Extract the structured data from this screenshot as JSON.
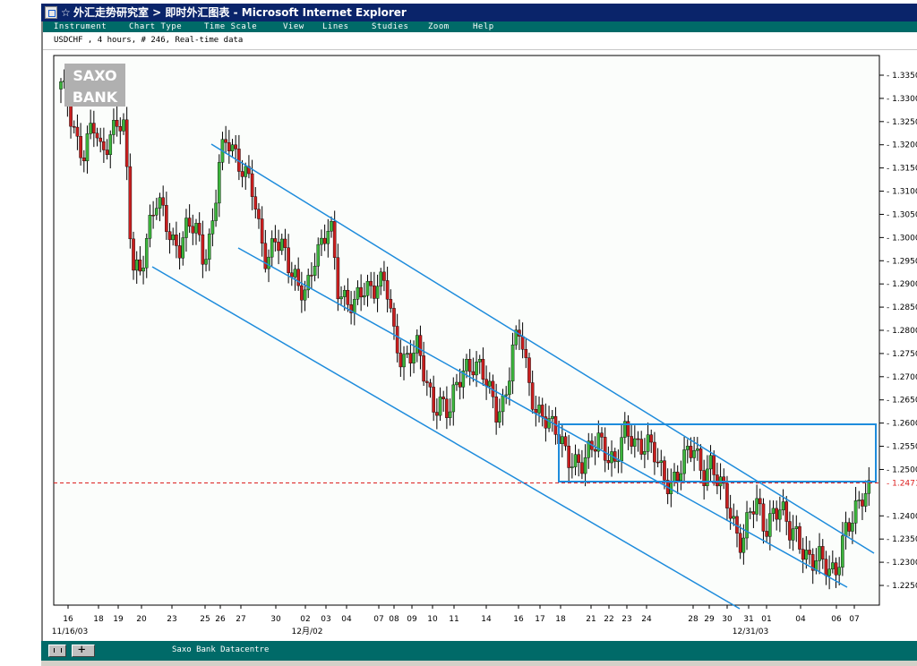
{
  "window": {
    "title": "外汇走势研究室 > 即时外汇图表 - Microsoft Internet Explorer",
    "icon": "internet-explorer-icon",
    "favorite_icon": "star-icon"
  },
  "menu": {
    "items": [
      "Instrument",
      "Chart Type",
      "Time Scale",
      "View",
      "Lines",
      "Studies",
      "Zoom",
      "Help"
    ]
  },
  "chart_header": {
    "info": "USDCHF , 4 hours, # 246, Real-time data"
  },
  "logo": {
    "line1": "SAXO",
    "line2": "BANK"
  },
  "status": {
    "text": "Saxo Bank Datacentre"
  },
  "colors": {
    "up": "#3cb43c",
    "down": "#c81e1e",
    "trendline": "#1e8cdc",
    "price_line": "#dc1e1e",
    "menu_bg": "#006a68",
    "title_bg": "#0a246a"
  },
  "chart_data": {
    "type": "candlestick",
    "instrument": "USDCHF",
    "timeframe": "4 hours",
    "bars": 246,
    "current_price": "1.2471",
    "ylim": [
      1.22,
      1.34
    ],
    "y_ticks": [
      "1.3350",
      "1.3300",
      "1.3250",
      "1.3200",
      "1.3150",
      "1.3100",
      "1.3050",
      "1.3000",
      "1.2950",
      "1.2900",
      "1.2850",
      "1.2800",
      "1.2750",
      "1.2700",
      "1.2650",
      "1.2600",
      "1.2550",
      "1.2500",
      "1.2400",
      "1.2350",
      "1.2300",
      "1.2250"
    ],
    "x_ticks": [
      "16",
      "18",
      "19",
      "20",
      "23",
      "25",
      "26",
      "27",
      "30",
      "02",
      "03",
      "04",
      "07",
      "08",
      "09",
      "10",
      "11",
      "14",
      "16",
      "17",
      "18",
      "21",
      "22",
      "23",
      "24",
      "28",
      "29",
      "30",
      "31",
      "01",
      "04",
      "06",
      "07"
    ],
    "x_date_labels": [
      "11/16/03",
      "12月/02",
      "12/31/03"
    ],
    "path": [
      1.332,
      1.328,
      1.322,
      1.318,
      1.324,
      1.318,
      1.322,
      1.326,
      1.322,
      1.293,
      1.294,
      1.302,
      1.307,
      1.304,
      1.3,
      1.299,
      1.302,
      1.301,
      1.296,
      1.302,
      1.316,
      1.32,
      1.318,
      1.316,
      1.312,
      1.3,
      1.294,
      1.302,
      1.298,
      1.291,
      1.289,
      1.29,
      1.296,
      1.297,
      1.303,
      1.29,
      1.287,
      1.284,
      1.288,
      1.29,
      1.291,
      1.29,
      1.278,
      1.274,
      1.276,
      1.276,
      1.268,
      1.264,
      1.266,
      1.262,
      1.267,
      1.272,
      1.274,
      1.272,
      1.266,
      1.262,
      1.266,
      1.276,
      1.279,
      1.268,
      1.264,
      1.262,
      1.258,
      1.256,
      1.254,
      1.252,
      1.25,
      1.254,
      1.258,
      1.254,
      1.25,
      1.257,
      1.258,
      1.256,
      1.255,
      1.252,
      1.249,
      1.248,
      1.249,
      1.252,
      1.255,
      1.25,
      1.251,
      1.246,
      1.244,
      1.239,
      1.234,
      1.24,
      1.242,
      1.238,
      1.242,
      1.24,
      1.236,
      1.237,
      1.232,
      1.229,
      1.23,
      1.229,
      1.23,
      1.236,
      1.238,
      1.245,
      1.247
    ]
  }
}
